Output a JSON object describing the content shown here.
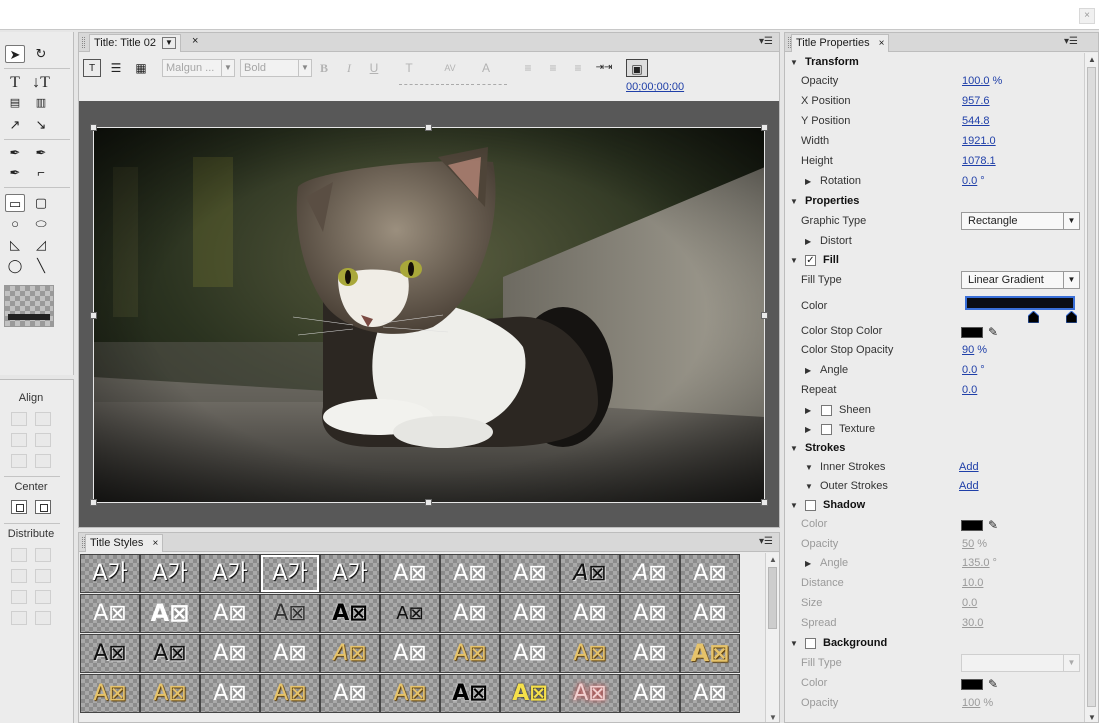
{
  "title_panel": {
    "tab_label": "Title: Title 02",
    "tab_close": "×",
    "font_family": "Malgun ...",
    "font_style": "Bold",
    "timecode": "00;00;00;00"
  },
  "align_panel": {
    "align_header": "Align",
    "center_header": "Center",
    "distribute_header": "Distribute"
  },
  "styles_panel": {
    "tab_label": "Title Styles",
    "tab_close": "×",
    "cells": [
      "A가",
      "A가",
      "A가",
      "A가",
      "A가",
      "A⊠",
      "A⊠",
      "A⊠",
      "A⊠",
      "A⊠",
      "A⊠",
      "A⊠",
      "A⊠",
      "A⊠",
      "A⊠",
      "A⊠",
      "A⊠",
      "A⊠",
      "A⊠",
      "A⊠",
      "A⊠",
      "A⊠",
      "A⊠",
      "A⊠",
      "A⊠",
      "A⊠",
      "A⊠",
      "A⊠",
      "A⊠",
      "A⊠",
      "A⊠",
      "A⊠",
      "A⊠",
      "A⊠",
      "A⊠",
      "A⊠",
      "A⊠",
      "A⊠",
      "A⊠",
      "A⊠",
      "A⊠",
      "A⊠",
      "A⊠",
      "A⊠"
    ]
  },
  "props_panel": {
    "tab_label": "Title Properties",
    "tab_close": "×",
    "transform": "Transform",
    "opacity_label": "Opacity",
    "opacity_value": "100.0",
    "opacity_unit": "%",
    "x_label": "X Position",
    "x_value": "957.6",
    "y_label": "Y Position",
    "y_value": "544.8",
    "width_label": "Width",
    "width_value": "1921.0",
    "height_label": "Height",
    "height_value": "1078.1",
    "rotation_label": "Rotation",
    "rotation_value": "0.0",
    "rotation_unit": "°",
    "properties": "Properties",
    "graphic_type_label": "Graphic Type",
    "graphic_type_value": "Rectangle",
    "distort_label": "Distort",
    "fill": "Fill",
    "fill_type_label": "Fill Type",
    "fill_type_value": "Linear Gradient",
    "color_label": "Color",
    "color_stop_color_label": "Color Stop Color",
    "color_stop_opacity_label": "Color Stop Opacity",
    "color_stop_opacity_value": "90",
    "color_stop_opacity_unit": "%",
    "angle_label": "Angle",
    "angle_value": "0.0",
    "angle_unit": "°",
    "repeat_label": "Repeat",
    "repeat_value": "0.0",
    "sheen_label": "Sheen",
    "texture_label": "Texture",
    "strokes": "Strokes",
    "inner_strokes_label": "Inner Strokes",
    "inner_strokes_add": "Add",
    "outer_strokes_label": "Outer Strokes",
    "outer_strokes_add": "Add",
    "shadow": "Shadow",
    "shadow_color_label": "Color",
    "shadow_opacity_label": "Opacity",
    "shadow_opacity_value": "50",
    "shadow_opacity_unit": "%",
    "shadow_angle_label": "Angle",
    "shadow_angle_value": "135.0",
    "shadow_angle_unit": "°",
    "shadow_distance_label": "Distance",
    "shadow_distance_value": "10.0",
    "shadow_size_label": "Size",
    "shadow_size_value": "0.0",
    "shadow_spread_label": "Spread",
    "shadow_spread_value": "30.0",
    "background": "Background",
    "bg_fill_type_label": "Fill Type",
    "bg_color_label": "Color",
    "bg_opacity_label": "Opacity",
    "bg_opacity_value": "100",
    "bg_opacity_unit": "%"
  }
}
